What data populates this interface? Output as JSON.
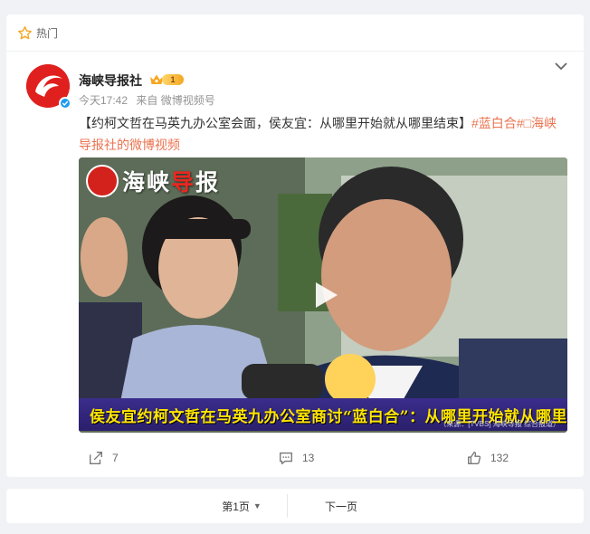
{
  "section": {
    "title": "热门"
  },
  "post": {
    "author": "海峡导报社",
    "vip_level": "1",
    "time": "今天17:42",
    "source": "来自 微博视频号",
    "text_main": "【约柯文哲在马英九办公室会面，侯友宜：从哪里开始就从哪里结束】",
    "tag": "#蓝白合#",
    "link": "□海峡导报社的微博视频",
    "video": {
      "logo_text": "海峡",
      "logo_text_red": "导",
      "logo_text_end": "报",
      "caption": "侯友宜约柯文哲在马英九办公室商讨“蓝白合”：从哪里开始就从哪里结束",
      "caption_sub": "（来源：[TVBS] 海峡导报 综合报道）"
    },
    "actions": {
      "share": "7",
      "comment": "13",
      "like": "132"
    }
  },
  "pager": {
    "current": "第1页",
    "next": "下一页"
  },
  "colors": {
    "brand_red": "#e0201e",
    "tag": "#eb7350",
    "caption": "#ffe600"
  },
  "icons": [
    "star-icon",
    "verified-icon",
    "crown-icon",
    "chevron-down-icon",
    "play-icon",
    "share-icon",
    "comment-icon",
    "like-icon"
  ]
}
